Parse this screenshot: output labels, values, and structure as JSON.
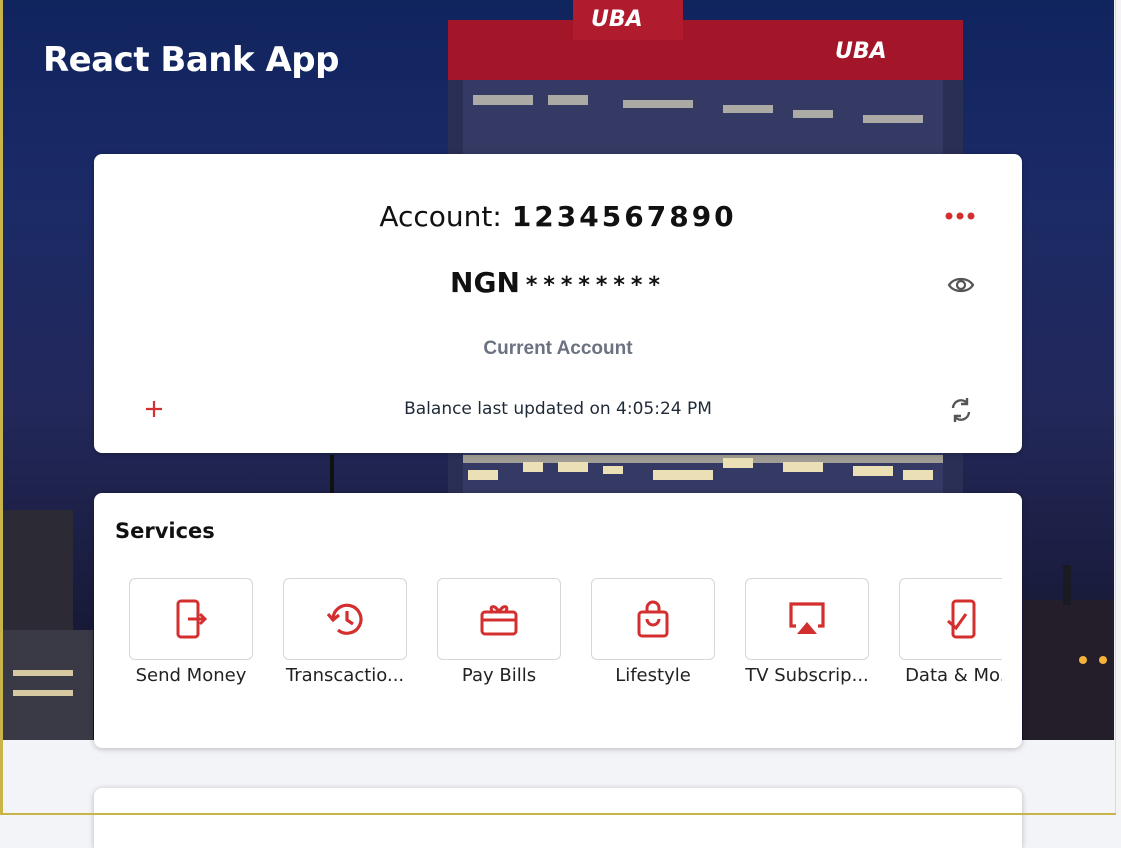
{
  "app": {
    "title": "React Bank App"
  },
  "account": {
    "label": "Account:",
    "number": "1234567890",
    "currency": "NGN",
    "balance_masked": "********",
    "type": "Current Account",
    "last_updated": "Balance last updated on 4:05:24 PM",
    "more_icon": "more-dots-icon",
    "eye_icon": "eye-icon",
    "add_icon": "plus-icon",
    "refresh_icon": "refresh-icon"
  },
  "services": {
    "title": "Services",
    "items": [
      {
        "label": "Send Money",
        "icon": "phone-send-icon"
      },
      {
        "label": "Transcactio...",
        "icon": "history-icon"
      },
      {
        "label": "Pay Bills",
        "icon": "gift-card-icon"
      },
      {
        "label": "Lifestyle",
        "icon": "shopping-bag-icon"
      },
      {
        "label": "TV Subscrip...",
        "icon": "airplay-icon"
      },
      {
        "label": "Data & Mo...",
        "icon": "phone-check-icon"
      }
    ]
  },
  "colors": {
    "accent": "#d32f2f",
    "hero": "#1b2a67",
    "muted": "#6b7280"
  }
}
